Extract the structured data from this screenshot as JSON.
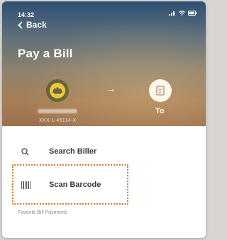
{
  "status_bar": {
    "time": "14:32"
  },
  "nav": {
    "back_label": "Back"
  },
  "page": {
    "title": "Pay a Bill"
  },
  "transfer": {
    "from_account": "XXX-1-45114-X",
    "to_label": "To"
  },
  "menu": {
    "search_label": "Search Biller",
    "scan_label": "Scan Barcode"
  },
  "favorites": {
    "section_label": "Favorite Bill Payments"
  },
  "colors": {
    "highlight": "#e07a2a",
    "logo_bg": "#5b5d32",
    "logo_fg": "#f0c43a"
  }
}
